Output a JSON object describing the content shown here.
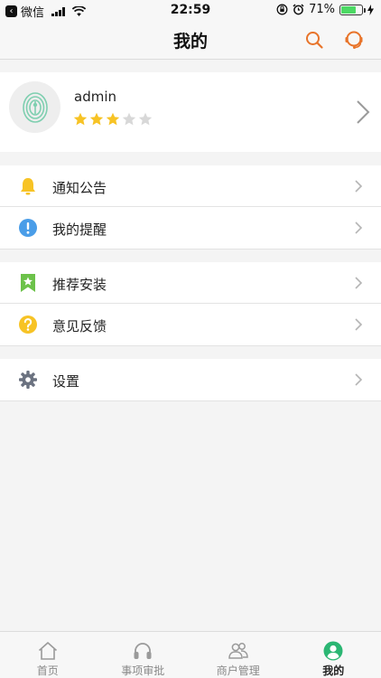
{
  "status_bar": {
    "carrier": "微信",
    "time": "22:59",
    "battery_percent": "71%",
    "battery_level": 0.71
  },
  "nav": {
    "title": "我的",
    "search_icon": "search-icon",
    "service_icon": "customer-service-icon"
  },
  "profile": {
    "username": "admin",
    "rating": 3,
    "rating_max": 5
  },
  "menu": {
    "groups": [
      [
        {
          "label": "通知公告",
          "icon": "bell-icon"
        },
        {
          "label": "我的提醒",
          "icon": "exclamation-icon"
        }
      ],
      [
        {
          "label": "推荐安装",
          "icon": "bookmark-star-icon"
        },
        {
          "label": "意见反馈",
          "icon": "question-icon"
        }
      ],
      [
        {
          "label": "设置",
          "icon": "gear-icon"
        }
      ]
    ]
  },
  "tabs": [
    {
      "label": "首页",
      "icon": "home-icon",
      "active": false
    },
    {
      "label": "事项审批",
      "icon": "headphones-icon",
      "active": false
    },
    {
      "label": "商户管理",
      "icon": "users-icon",
      "active": false
    },
    {
      "label": "我的",
      "icon": "profile-icon",
      "active": true
    }
  ],
  "colors": {
    "accent": "#e8742a",
    "active_tab": "#2bb673",
    "star_on": "#f7c325",
    "star_off": "#d8d8d8"
  }
}
